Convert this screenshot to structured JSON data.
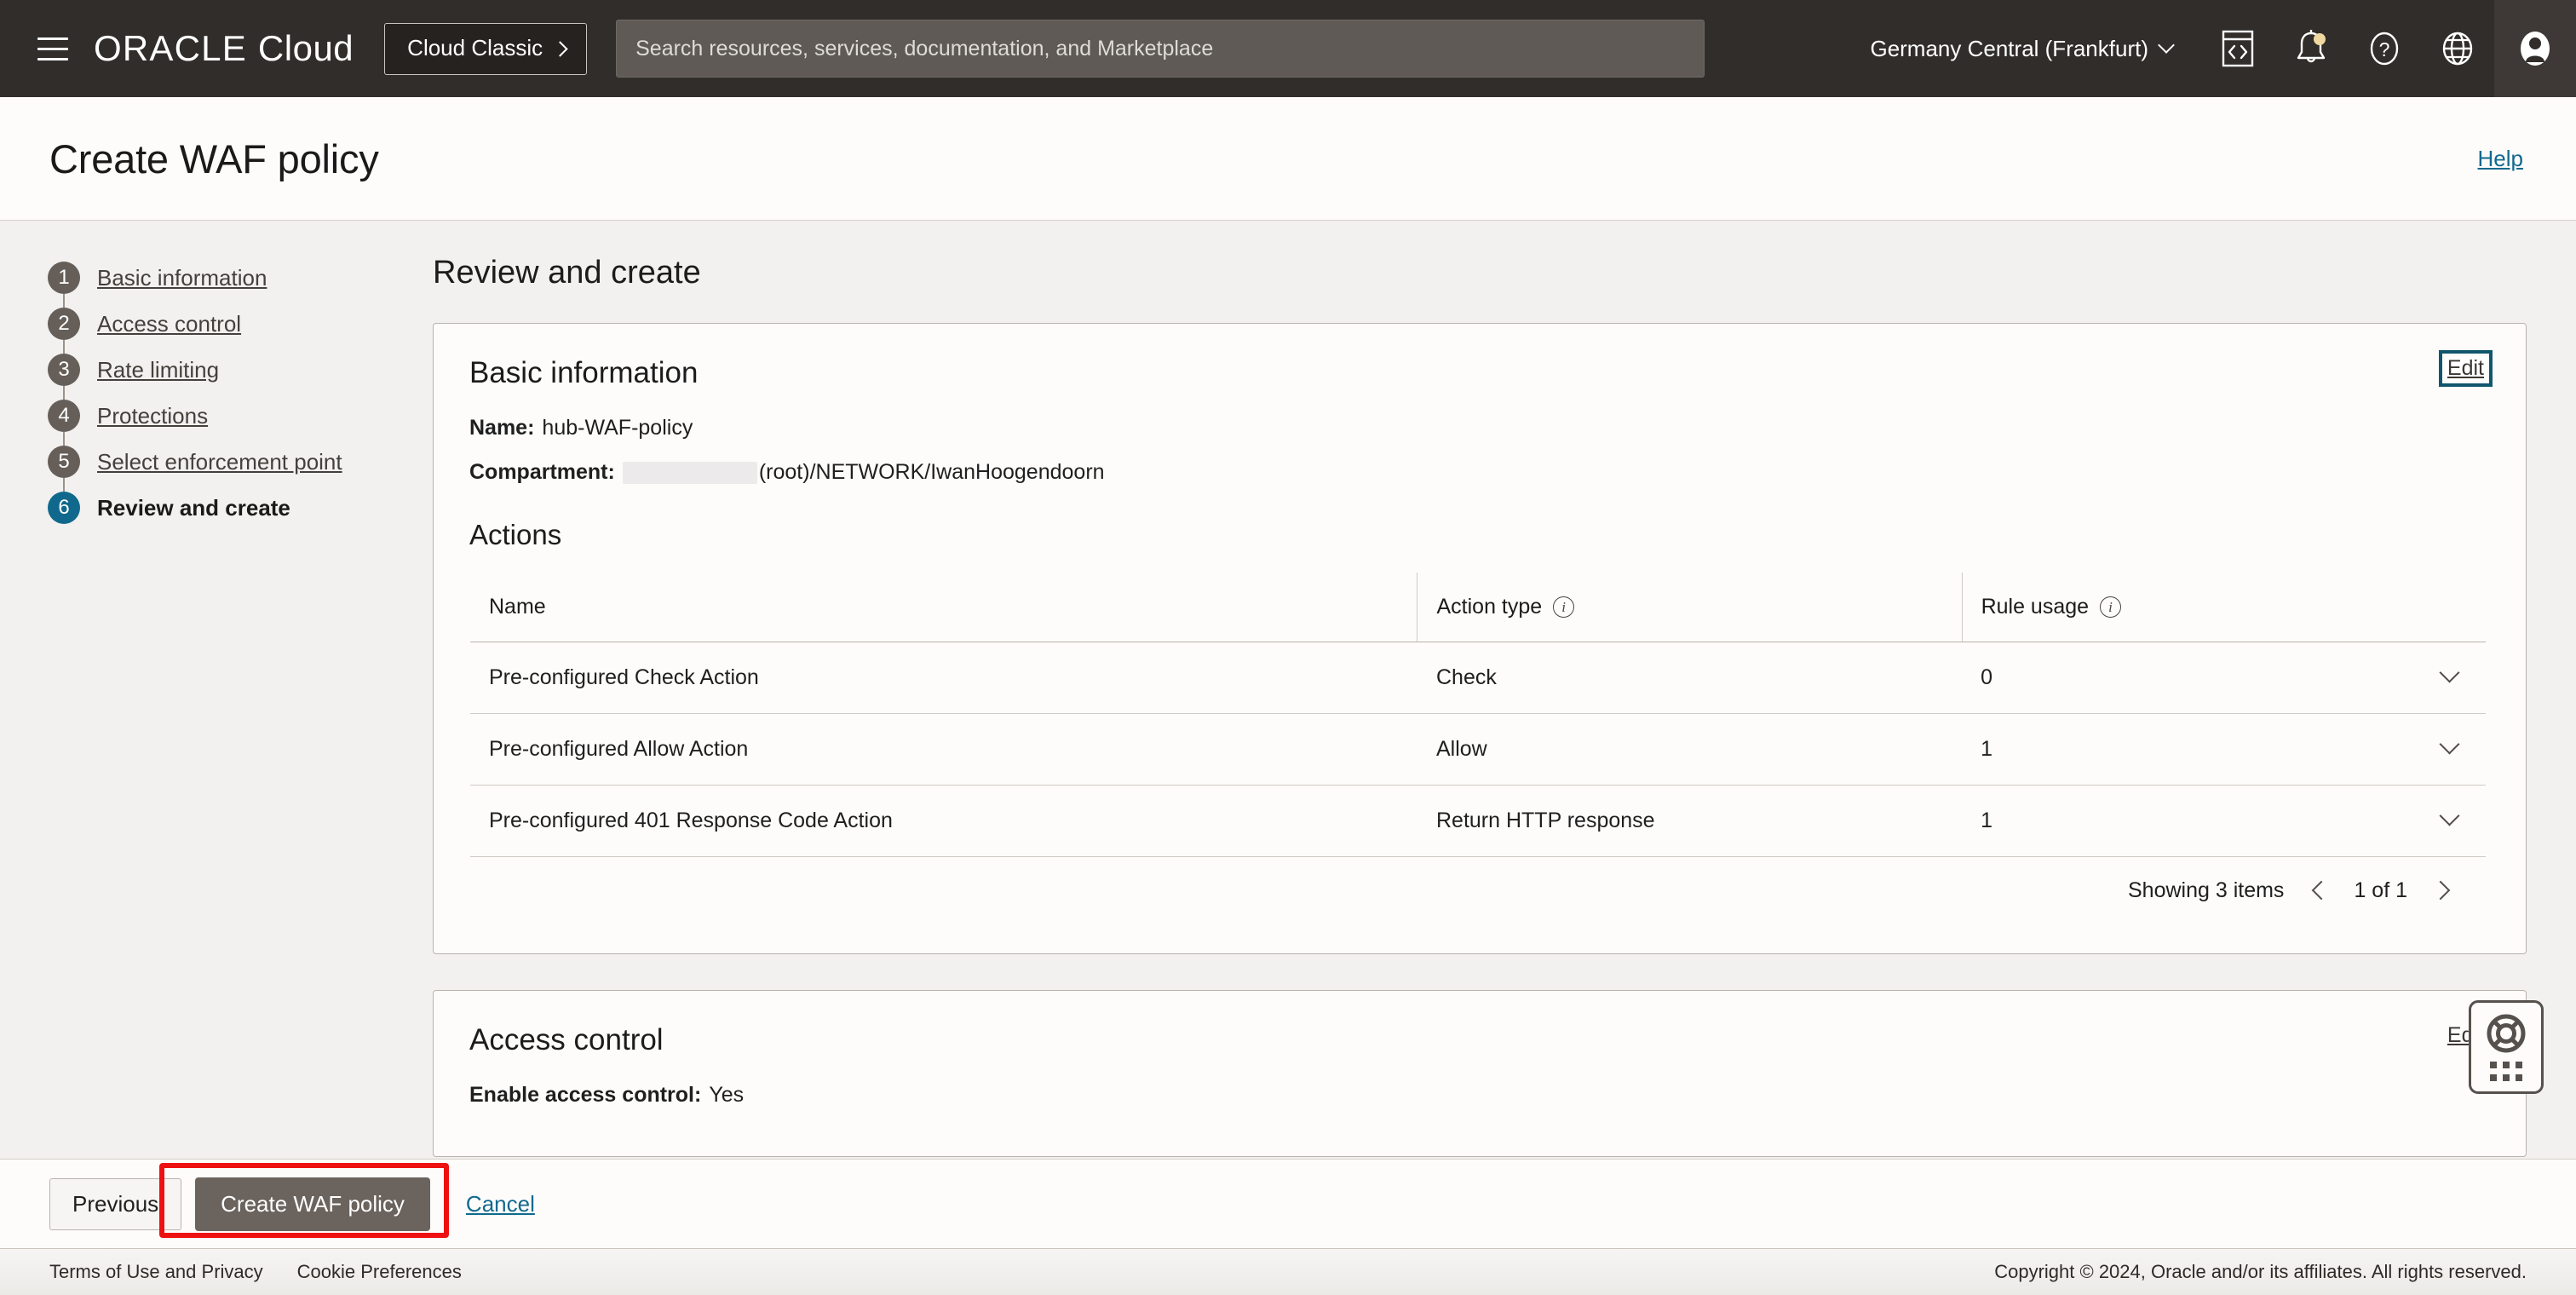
{
  "topnav": {
    "menu_icon": "hamburger-icon",
    "brand_primary": "ORACLE",
    "brand_secondary": "Cloud",
    "cloud_classic_label": "Cloud Classic",
    "search_placeholder": "Search resources, services, documentation, and Marketplace",
    "search_value": "",
    "region": "Germany Central (Frankfurt)",
    "icons": [
      {
        "name": "cloud-shell-icon",
        "label": "Cloud Shell"
      },
      {
        "name": "notifications-bell-icon",
        "label": "Notifications"
      },
      {
        "name": "help-question-icon",
        "label": "Help"
      },
      {
        "name": "language-globe-icon",
        "label": "Language"
      },
      {
        "name": "user-avatar-icon",
        "label": "Profile"
      }
    ],
    "accent_notification": "#f0d9a0"
  },
  "titlebar": {
    "title": "Create WAF policy",
    "help_label": "Help",
    "help_color": "#11698e"
  },
  "stepnav": {
    "current_step_color": "#10698c",
    "steps": [
      {
        "number": "1",
        "label": "Basic information",
        "current": false
      },
      {
        "number": "2",
        "label": "Access control",
        "current": false
      },
      {
        "number": "3",
        "label": "Rate limiting",
        "current": false
      },
      {
        "number": "4",
        "label": "Protections",
        "current": false
      },
      {
        "number": "5",
        "label": "Select enforcement point",
        "current": false
      },
      {
        "number": "6",
        "label": "Review and create",
        "current": true
      }
    ]
  },
  "main": {
    "heading": "Review and create",
    "basic_info": {
      "title": "Basic information",
      "edit_label": "Edit",
      "name_label": "Name:",
      "name_value": "hub-WAF-policy",
      "compartment_label": "Compartment:",
      "compartment_value": "(root)/NETWORK/IwanHoogendoorn",
      "actions_title": "Actions",
      "table": {
        "columns": [
          {
            "label": "Name",
            "info": false
          },
          {
            "label": "Action type",
            "info": true
          },
          {
            "label": "Rule usage",
            "info": true
          }
        ],
        "rows": [
          {
            "name": "Pre-configured Check Action",
            "type": "Check",
            "usage": "0"
          },
          {
            "name": "Pre-configured Allow Action",
            "type": "Allow",
            "usage": "1"
          },
          {
            "name": "Pre-configured 401 Response Code Action",
            "type": "Return HTTP response",
            "usage": "1"
          }
        ],
        "showing": "Showing 3 items",
        "page_indicator": "1 of 1"
      }
    },
    "access_control": {
      "title": "Access control",
      "edit_label": "Edit",
      "enable_label": "Enable access control:",
      "enable_value": "Yes"
    }
  },
  "support_widget": {
    "icon": "life-preserver-icon",
    "handle": "drag-handle-dots"
  },
  "actionbar": {
    "previous_label": "Previous",
    "create_label": "Create WAF policy",
    "cancel_label": "Cancel",
    "highlight_color": "#ee1111"
  },
  "footer": {
    "terms_label": "Terms of Use and Privacy",
    "cookie_label": "Cookie Preferences",
    "copyright": "Copyright © 2024, Oracle and/or its affiliates. All rights reserved."
  }
}
